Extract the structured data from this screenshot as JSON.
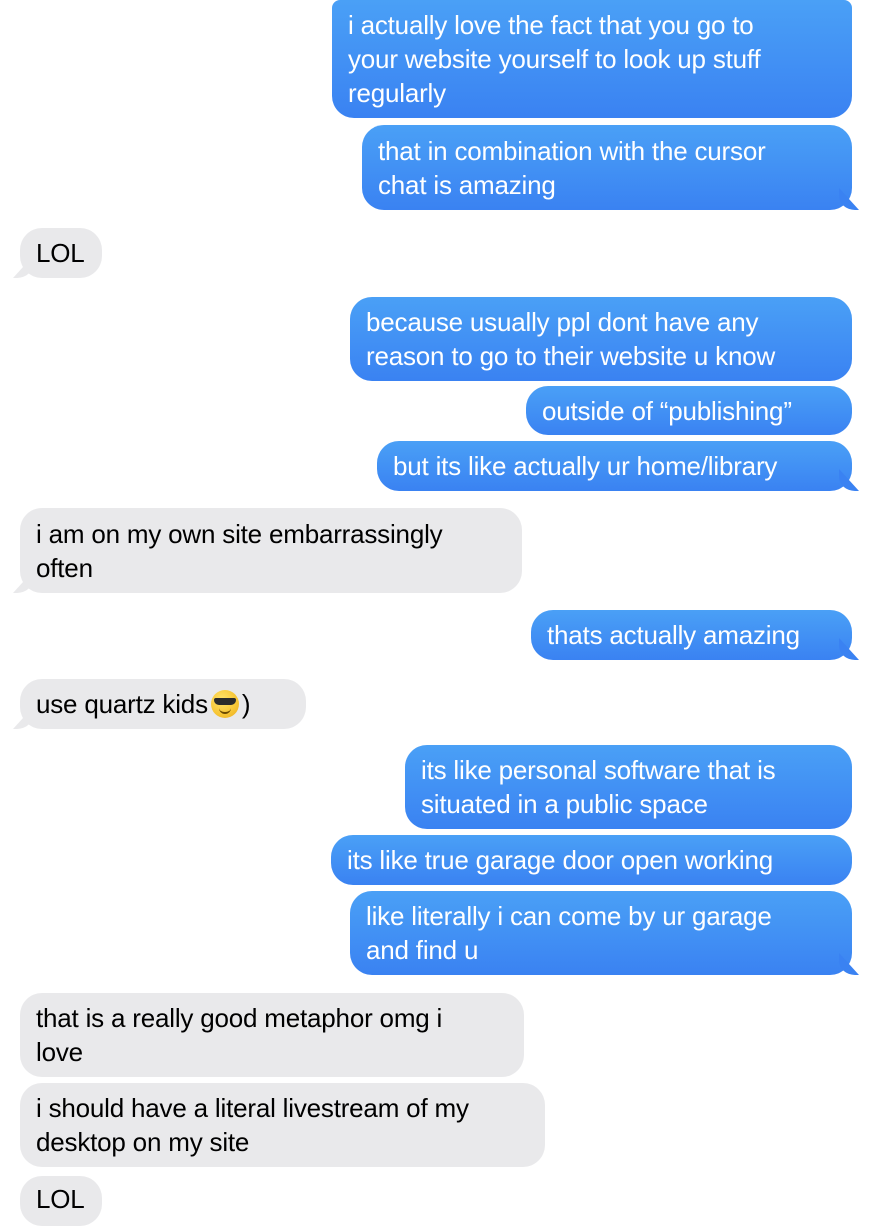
{
  "messages": [
    {
      "from": "me",
      "text": "i actually love the fact that you go to\nyour website yourself to look up stuff\nregularly"
    },
    {
      "from": "me",
      "text": "that in combination with the cursor\nchat is amazing"
    },
    {
      "from": "them",
      "text": "LOL"
    },
    {
      "from": "me",
      "text": "because usually ppl dont have any\nreason to go to their website u know"
    },
    {
      "from": "me",
      "text": "outside of “publishing”"
    },
    {
      "from": "me",
      "text": "but its like actually ur home/library"
    },
    {
      "from": "them",
      "text": "i am on my own site embarrassingly\noften"
    },
    {
      "from": "me",
      "text": "thats actually amazing"
    },
    {
      "from": "them",
      "text_before": "use quartz kids",
      "emoji": "smiling-face-with-sunglasses",
      "text_after": ")"
    },
    {
      "from": "me",
      "text": "its like personal software that is\nsituated in a public space"
    },
    {
      "from": "me",
      "text": "its like true garage door open working"
    },
    {
      "from": "me",
      "text": "like literally i can come by ur garage\nand find u"
    },
    {
      "from": "them",
      "text": "that is a really good metaphor omg i\nlove"
    },
    {
      "from": "them",
      "text": "i should have a literal livestream of my\ndesktop on my site"
    },
    {
      "from": "them",
      "text": "LOL"
    }
  ],
  "colors": {
    "sent_bubble": "#3a82f2",
    "received_bubble": "#e9e9eb",
    "background": "#ffffff"
  }
}
